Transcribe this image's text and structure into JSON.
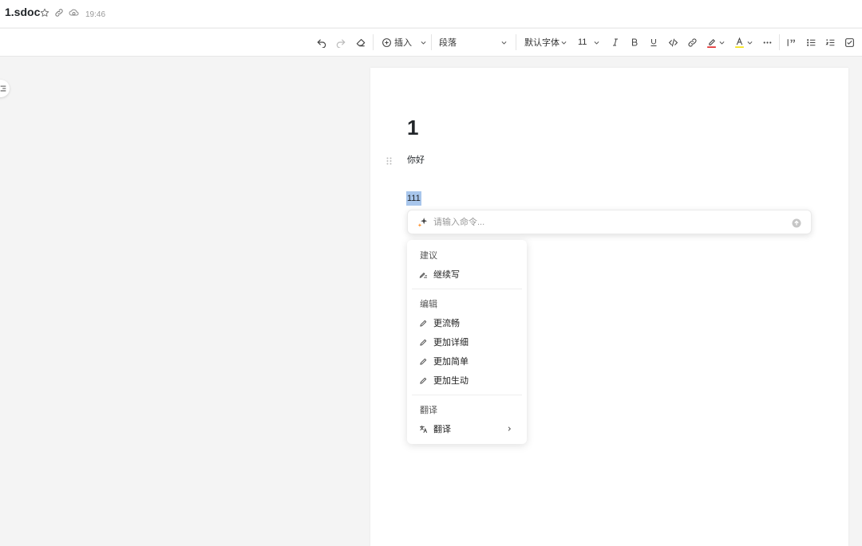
{
  "header": {
    "title": "1.sdoc",
    "time": "19:46"
  },
  "toolbar": {
    "insert_label": "插入",
    "paragraph_select": "段落",
    "font_select": "默认字体",
    "font_size": "11",
    "text_color": "#e02020",
    "highlight_color": "#f5e000"
  },
  "document": {
    "heading": "1",
    "paragraph": "你好",
    "selected_text": "111"
  },
  "ai_command": {
    "placeholder": "请输入命令..."
  },
  "ai_menu": {
    "sections": [
      {
        "title": "建议",
        "items": [
          {
            "label": "继续写",
            "icon": "continue-write-icon"
          }
        ]
      },
      {
        "title": "编辑",
        "items": [
          {
            "label": "更流畅",
            "icon": "pencil-icon"
          },
          {
            "label": "更加详细",
            "icon": "pencil-icon"
          },
          {
            "label": "更加简单",
            "icon": "pencil-icon"
          },
          {
            "label": "更加生动",
            "icon": "pencil-icon"
          }
        ]
      },
      {
        "title": "翻译",
        "items": [
          {
            "label": "翻译",
            "icon": "translate-icon",
            "submenu": true
          }
        ]
      }
    ]
  }
}
